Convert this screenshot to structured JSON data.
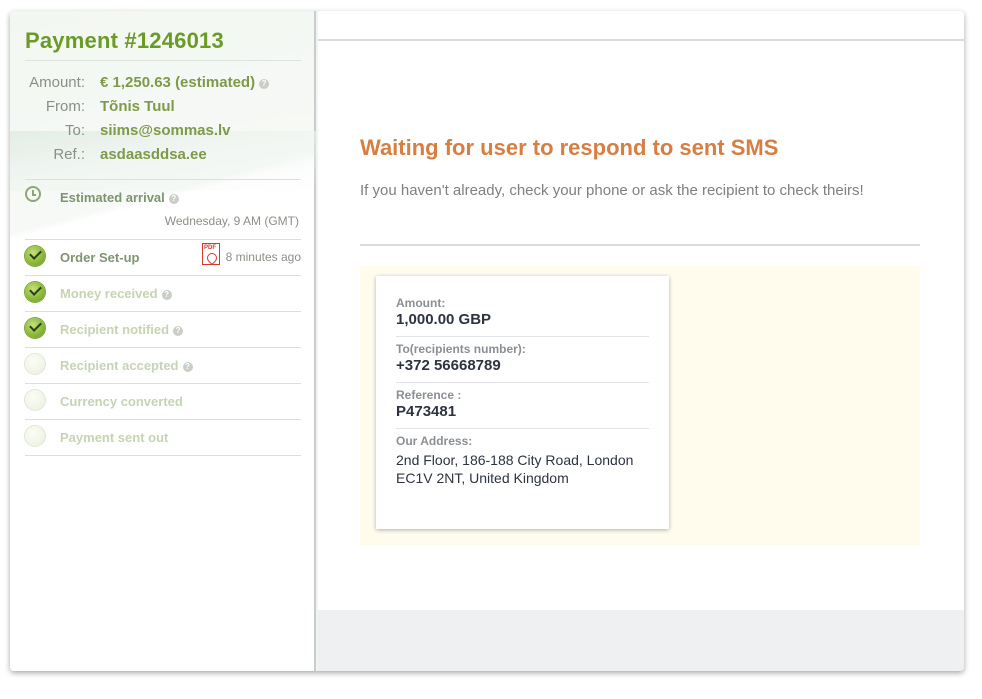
{
  "sidebar": {
    "title": "Payment #1246013",
    "info": [
      {
        "label": "Amount:",
        "value": "€ 1,250.63 (estimated)",
        "help": true
      },
      {
        "label": "From:",
        "value": "Tõnis Tuul",
        "help": false
      },
      {
        "label": "To:",
        "value": "siims@sommas.lv",
        "help": false
      },
      {
        "label": "Ref.:",
        "value": "asdaasddsa.ee",
        "help": false
      }
    ],
    "eta": {
      "label": "Estimated arrival",
      "date": "Wednesday, 9 AM (GMT)"
    },
    "steps": [
      {
        "label": "Order Set-up",
        "state": "done",
        "time": "8 minutes ago",
        "pdf": true
      },
      {
        "label": "Money received",
        "state": "done",
        "help": true
      },
      {
        "label": "Recipient notified",
        "state": "done",
        "help": true
      },
      {
        "label": "Recipient accepted",
        "state": "pending",
        "help": true
      },
      {
        "label": "Currency converted",
        "state": "pending"
      },
      {
        "label": "Payment sent out",
        "state": "pending"
      }
    ],
    "help_glyph": "?"
  },
  "main": {
    "title": "Waiting for user to respond to sent SMS",
    "subtitle": "If you haven't already, check your phone or ask the recipient to check theirs!",
    "card": {
      "amount_label": "Amount:",
      "amount_value": "1,000.00 GBP",
      "to_label": "To(recipients number):",
      "to_value": "+372 56668789",
      "ref_label": "Reference :",
      "ref_value": "P473481",
      "address_label": "Our Address:",
      "address_value": "2nd Floor, 186-188 City Road, London EC1V 2NT, United Kingdom"
    }
  },
  "colors": {
    "brand_green": "#6a9b27",
    "accent_orange": "#d77e42",
    "cream": "#fffcee"
  },
  "icons": {
    "eta": "clock-icon",
    "done": "check-badge-icon",
    "pending": "empty-badge-icon",
    "pdf": "pdf-icon",
    "help": "help-icon"
  }
}
